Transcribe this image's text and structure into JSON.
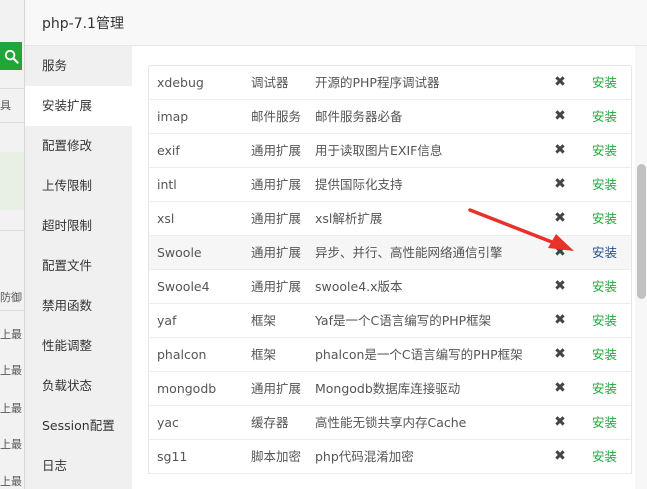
{
  "background": {
    "fragments": [
      "具",
      "防御",
      "上最",
      "上最",
      "上最",
      "上最",
      "上最",
      "上最"
    ]
  },
  "dialog": {
    "title": "php-7.1管理"
  },
  "sidebar": {
    "items": [
      {
        "label": "服务"
      },
      {
        "label": "安装扩展"
      },
      {
        "label": "配置修改"
      },
      {
        "label": "上传限制"
      },
      {
        "label": "超时限制"
      },
      {
        "label": "配置文件"
      },
      {
        "label": "禁用函数"
      },
      {
        "label": "性能调整"
      },
      {
        "label": "负载状态"
      },
      {
        "label": "Session配置"
      },
      {
        "label": "日志"
      }
    ],
    "active_index": 1
  },
  "extensions": [
    {
      "name": "xdebug",
      "type": "调试器",
      "desc": "开源的PHP程序调试器",
      "status": "✖",
      "action": "安装"
    },
    {
      "name": "imap",
      "type": "邮件服务",
      "desc": "邮件服务器必备",
      "status": "✖",
      "action": "安装"
    },
    {
      "name": "exif",
      "type": "通用扩展",
      "desc": "用于读取图片EXIF信息",
      "status": "✖",
      "action": "安装"
    },
    {
      "name": "intl",
      "type": "通用扩展",
      "desc": "提供国际化支持",
      "status": "✖",
      "action": "安装"
    },
    {
      "name": "xsl",
      "type": "通用扩展",
      "desc": "xsl解析扩展",
      "status": "✖",
      "action": "安装"
    },
    {
      "name": "Swoole",
      "type": "通用扩展",
      "desc": "异步、并行、高性能网络通信引擎",
      "status": "✖",
      "action": "安装"
    },
    {
      "name": "Swoole4",
      "type": "通用扩展",
      "desc": "swoole4.x版本",
      "status": "✖",
      "action": "安装"
    },
    {
      "name": "yaf",
      "type": "框架",
      "desc": "Yaf是一个C语言编写的PHP框架",
      "status": "✖",
      "action": "安装"
    },
    {
      "name": "phalcon",
      "type": "框架",
      "desc": "phalcon是一个C语言编写的PHP框架",
      "status": "✖",
      "action": "安装"
    },
    {
      "name": "mongodb",
      "type": "通用扩展",
      "desc": "Mongodb数据库连接驱动",
      "status": "✖",
      "action": "安装"
    },
    {
      "name": "yac",
      "type": "缓存器",
      "desc": "高性能无锁共享内存Cache",
      "status": "✖",
      "action": "安装"
    },
    {
      "name": "sg11",
      "type": "脚本加密",
      "desc": "php代码混淆加密",
      "status": "✖",
      "action": "安装"
    }
  ],
  "hover_row_index": 5,
  "colors": {
    "install_link": "#20a53a",
    "install_link_hover": "#1e4d8f",
    "annotation_arrow": "#e8312a"
  }
}
